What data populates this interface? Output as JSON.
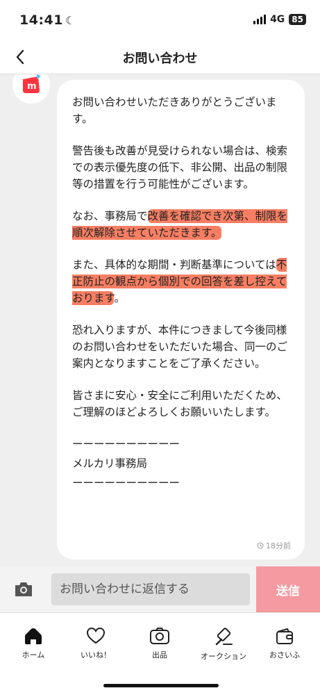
{
  "status_bar": {
    "time": "14:41",
    "network": "4G",
    "battery": "85"
  },
  "nav": {
    "title": "お問い合わせ"
  },
  "message": {
    "paragraphs": [
      [
        {
          "text": "お問い合わせいただきありがとうございます。",
          "highlight": false
        }
      ],
      [
        {
          "text": "警告後も改善が見受けられない場合は、検索での表示優先度の低下、非公開、出品の制限等の措置を行う可能性がございます。",
          "highlight": false
        }
      ],
      [
        {
          "text": "なお、事務局で",
          "highlight": false
        },
        {
          "text": "改善を確認でき次第、制限を順次解除させていただきます。",
          "highlight": true
        }
      ],
      [
        {
          "text": "また、具体的な期間・判断基準については",
          "highlight": false
        },
        {
          "text": "不正防止の観点から個別での回答を差し控えております",
          "highlight": true
        },
        {
          "text": "。",
          "highlight": false
        }
      ],
      [
        {
          "text": "恐れ入りますが、本件につきまして今後同様のお問い合わせをいただいた場合、同一のご案内となりますことをご了承ください。",
          "highlight": false
        }
      ],
      [
        {
          "text": "皆さまに安心・安全にご利用いただくため、ご理解のほどよろしくお願いいたします。",
          "highlight": false
        }
      ]
    ],
    "signature_line1": "ーーーーーーーーーー",
    "signature_name": "メルカリ事務局",
    "signature_line2": "ーーーーーーーーーー",
    "timestamp": "18分前"
  },
  "reply": {
    "placeholder": "お問い合わせに返信する",
    "send_label": "送信"
  },
  "tabs": [
    {
      "label": "ホーム",
      "icon": "home-icon"
    },
    {
      "label": "いいね！",
      "icon": "heart-icon"
    },
    {
      "label": "出品",
      "icon": "camera-icon"
    },
    {
      "label": "オークション",
      "icon": "gavel-icon"
    },
    {
      "label": "おさいふ",
      "icon": "wallet-icon"
    }
  ],
  "colors": {
    "brand": "#ff333f",
    "highlight": "#f55a37",
    "send_button": "#f59aa0"
  }
}
